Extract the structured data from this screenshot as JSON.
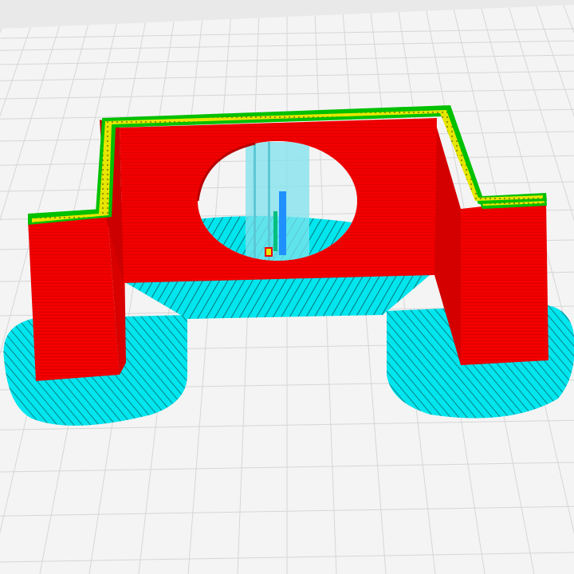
{
  "viewport": {
    "view": "layer-preview",
    "colors": {
      "background": "#f4f4f4",
      "grid_line": "#d8d8d8",
      "wall": "#f20000",
      "wall_line": "#c80000",
      "wall_top_outer": "#00c000",
      "wall_top_inner": "#e6e600",
      "skirt": "#00e5ee",
      "skirt_line": "#0a5a5a",
      "support": "#7fe3ee",
      "infill_blue": "#1e90ff"
    }
  },
  "model": {
    "parts": [
      {
        "name": "left-foot"
      },
      {
        "name": "front-wall"
      },
      {
        "name": "right-foot"
      },
      {
        "name": "round-hole"
      }
    ]
  }
}
